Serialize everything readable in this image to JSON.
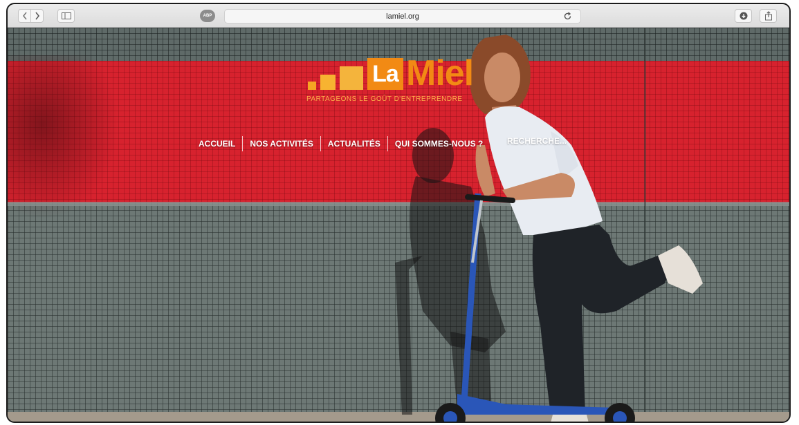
{
  "browser": {
    "url": "lamiel.org",
    "adblock_badge": "ABP"
  },
  "site": {
    "logo": {
      "la": "La",
      "miel": "Miel",
      "tagline": "PARTAGEONS LE GOÛT D'ENTREPRENDRE"
    },
    "nav": {
      "items": [
        {
          "label": "ACCUEIL"
        },
        {
          "label": "NOS ACTIVITÉS"
        },
        {
          "label": "ACTUALITÉS"
        },
        {
          "label": "QUI SOMMES-NOUS ?"
        }
      ],
      "search_label": "RECHERCHE..."
    }
  },
  "colors": {
    "brand_orange": "#f28a14",
    "wall_red": "#d7222e",
    "tile_grey": "#6d7875"
  },
  "icons": [
    "back-icon",
    "forward-icon",
    "sidebar-icon",
    "reload-icon",
    "download-icon",
    "share-icon"
  ]
}
